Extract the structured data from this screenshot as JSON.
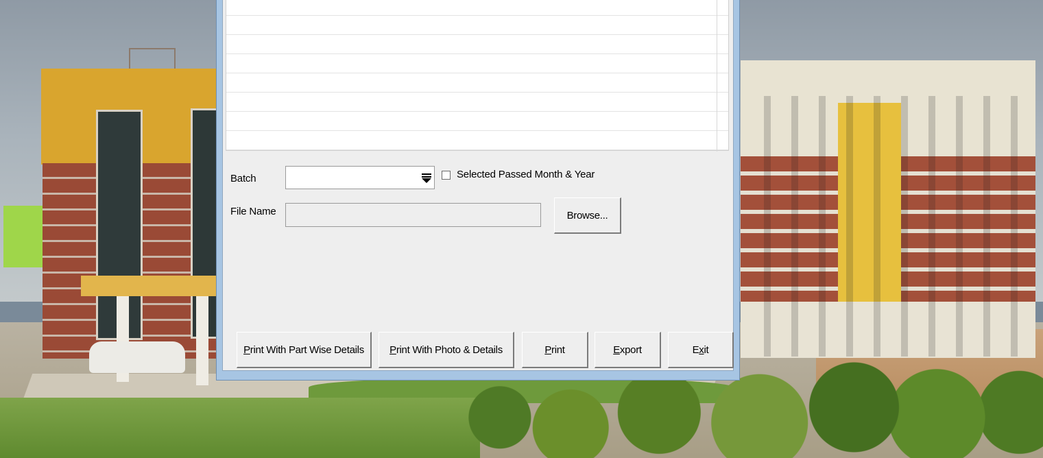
{
  "dialog": {
    "batch_label": "Batch",
    "batch_value": "",
    "dropdown_icon": "dropdown-arrow-icon",
    "checkbox_label": "Selected Passed Month & Year",
    "checkbox_checked": false,
    "file_name_label": "File Name",
    "file_name_value": "",
    "browse_label": "Browse...",
    "buttons": {
      "print_part_wise": {
        "label": "Print With Part Wise Details",
        "mnemonic": "P"
      },
      "print_photo": {
        "label": "Print With Photo & Details",
        "mnemonic": "P"
      },
      "print": {
        "label": "Print",
        "mnemonic": "P"
      },
      "export": {
        "label": "Export",
        "mnemonic": "E"
      },
      "exit": {
        "label": "Exit",
        "mnemonic": "x"
      }
    }
  },
  "colors": {
    "window_frame": "#a7c5e3",
    "dialog_bg": "#eeeeee",
    "grid_bg": "#ffffff"
  }
}
